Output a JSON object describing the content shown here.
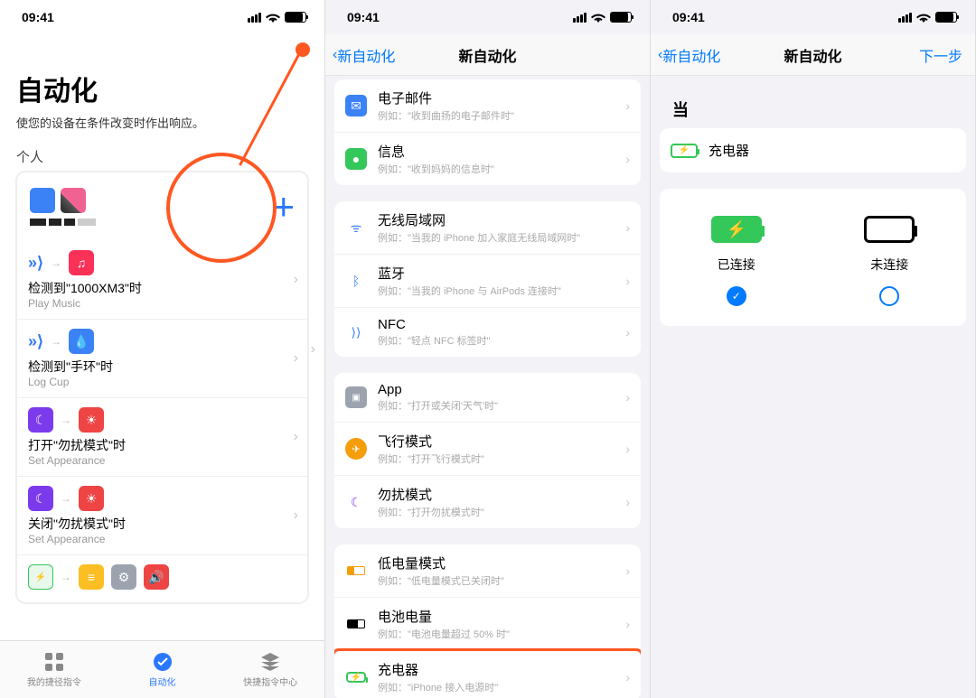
{
  "status": {
    "time": "09:41"
  },
  "phone1": {
    "title": "自动化",
    "subtitle": "使您的设备在条件改变时作出响应。",
    "section": "个人",
    "autos": [
      {
        "title": "检测到\"1000XM3\"时",
        "sub": "Play Music"
      },
      {
        "title": "检测到\"手环\"时",
        "sub": "Log Cup"
      },
      {
        "title": "打开\"勿扰模式\"时",
        "sub": "Set Appearance"
      },
      {
        "title": "关闭\"勿扰模式\"时",
        "sub": "Set Appearance"
      }
    ],
    "tabs": {
      "shortcuts": "我的捷径指令",
      "automation": "自动化",
      "gallery": "快捷指令中心"
    }
  },
  "phone2": {
    "back": "新自动化",
    "title": "新自动化",
    "triggers": {
      "g1": [
        {
          "title": "电子邮件",
          "sub": "例如：\"收到曲扬的电子邮件时\""
        },
        {
          "title": "信息",
          "sub": "例如：\"收到妈妈的信息时\""
        }
      ],
      "g2": [
        {
          "title": "无线局域网",
          "sub": "例如：\"当我的 iPhone 加入家庭无线局域网时\""
        },
        {
          "title": "蓝牙",
          "sub": "例如：\"当我的 iPhone 与 AirPods 连接时\""
        },
        {
          "title": "NFC",
          "sub": "例如：\"轻点 NFC 标签时\""
        }
      ],
      "g3": [
        {
          "title": "App",
          "sub": "例如：\"打开或关闭'天气'时\""
        },
        {
          "title": "飞行模式",
          "sub": "例如：\"打开飞行模式时\""
        },
        {
          "title": "勿扰模式",
          "sub": "例如：\"打开勿扰模式时\""
        }
      ],
      "g4": [
        {
          "title": "低电量模式",
          "sub": "例如：\"低电量模式已关闭时\""
        },
        {
          "title": "电池电量",
          "sub": "例如：\"电池电量超过 50% 时\""
        },
        {
          "title": "充电器",
          "sub": "例如：\"iPhone 接入电源时\""
        }
      ]
    }
  },
  "phone3": {
    "back": "新自动化",
    "title": "新自动化",
    "next": "下一步",
    "when": "当",
    "charger": "充电器",
    "connected": "已连接",
    "disconnected": "未连接"
  }
}
